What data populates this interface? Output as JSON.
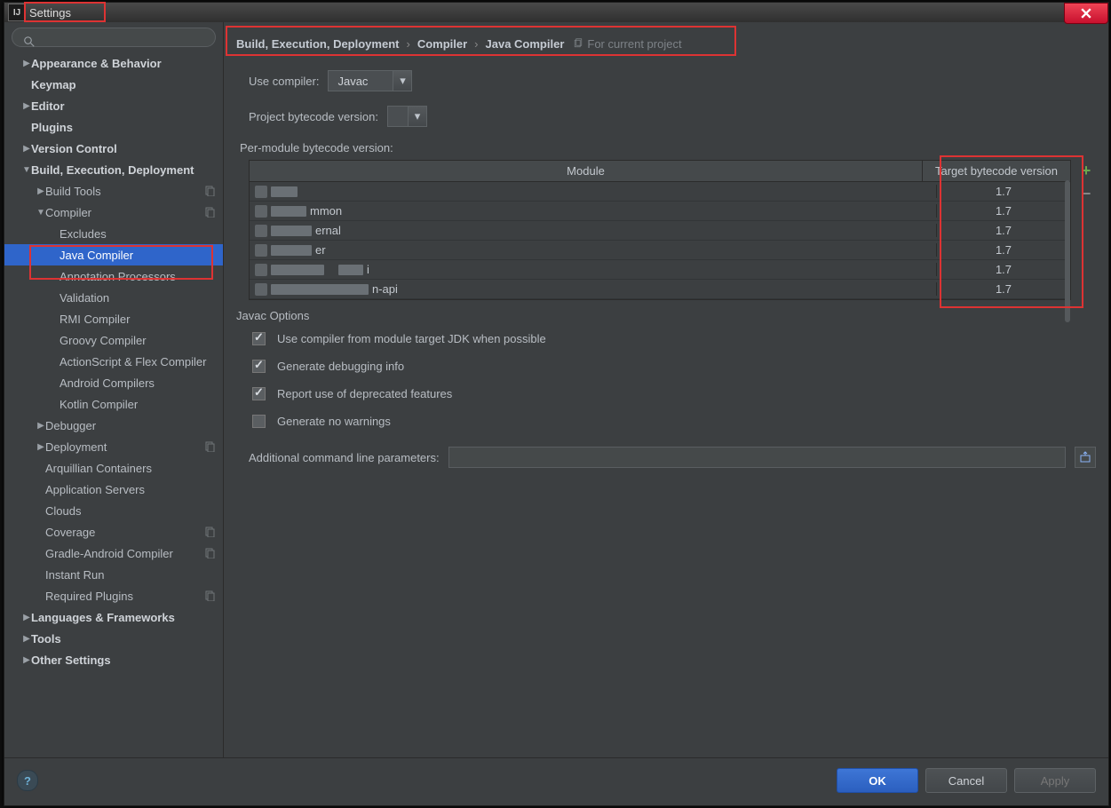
{
  "window": {
    "title": "Settings"
  },
  "search": {
    "placeholder": ""
  },
  "sidebar": [
    {
      "lvl": 1,
      "arrow": "▶",
      "bold": true,
      "label": "Appearance & Behavior"
    },
    {
      "lvl": 1,
      "arrow": "",
      "bold": true,
      "label": "Keymap"
    },
    {
      "lvl": 1,
      "arrow": "▶",
      "bold": true,
      "label": "Editor"
    },
    {
      "lvl": 1,
      "arrow": "",
      "bold": true,
      "label": "Plugins"
    },
    {
      "lvl": 1,
      "arrow": "▶",
      "bold": true,
      "label": "Version Control"
    },
    {
      "lvl": 1,
      "arrow": "▼",
      "bold": true,
      "label": "Build, Execution, Deployment"
    },
    {
      "lvl": 2,
      "arrow": "▶",
      "bold": false,
      "label": "Build Tools",
      "badge": true
    },
    {
      "lvl": 2,
      "arrow": "▼",
      "bold": false,
      "label": "Compiler",
      "badge": true
    },
    {
      "lvl": 3,
      "arrow": "",
      "bold": false,
      "label": "Excludes"
    },
    {
      "lvl": 3,
      "arrow": "",
      "bold": false,
      "label": "Java Compiler",
      "sel": true
    },
    {
      "lvl": 3,
      "arrow": "",
      "bold": false,
      "label": "Annotation Processors"
    },
    {
      "lvl": 3,
      "arrow": "",
      "bold": false,
      "label": "Validation"
    },
    {
      "lvl": 3,
      "arrow": "",
      "bold": false,
      "label": "RMI Compiler"
    },
    {
      "lvl": 3,
      "arrow": "",
      "bold": false,
      "label": "Groovy Compiler"
    },
    {
      "lvl": 3,
      "arrow": "",
      "bold": false,
      "label": "ActionScript & Flex Compiler"
    },
    {
      "lvl": 3,
      "arrow": "",
      "bold": false,
      "label": "Android Compilers"
    },
    {
      "lvl": 3,
      "arrow": "",
      "bold": false,
      "label": "Kotlin Compiler"
    },
    {
      "lvl": 2,
      "arrow": "▶",
      "bold": false,
      "label": "Debugger"
    },
    {
      "lvl": 2,
      "arrow": "▶",
      "bold": false,
      "label": "Deployment",
      "badge": true
    },
    {
      "lvl": 2,
      "arrow": "",
      "bold": false,
      "label": "Arquillian Containers"
    },
    {
      "lvl": 2,
      "arrow": "",
      "bold": false,
      "label": "Application Servers"
    },
    {
      "lvl": 2,
      "arrow": "",
      "bold": false,
      "label": "Clouds"
    },
    {
      "lvl": 2,
      "arrow": "",
      "bold": false,
      "label": "Coverage",
      "badge": true
    },
    {
      "lvl": 2,
      "arrow": "",
      "bold": false,
      "label": "Gradle-Android Compiler",
      "badge": true
    },
    {
      "lvl": 2,
      "arrow": "",
      "bold": false,
      "label": "Instant Run"
    },
    {
      "lvl": 2,
      "arrow": "",
      "bold": false,
      "label": "Required Plugins",
      "badge": true
    },
    {
      "lvl": 1,
      "arrow": "▶",
      "bold": true,
      "label": "Languages & Frameworks"
    },
    {
      "lvl": 1,
      "arrow": "▶",
      "bold": true,
      "label": "Tools"
    },
    {
      "lvl": 1,
      "arrow": "▶",
      "bold": true,
      "label": "Other Settings"
    }
  ],
  "breadcrumb": {
    "parts": [
      "Build, Execution, Deployment",
      "Compiler",
      "Java Compiler"
    ],
    "suffix": "For current project"
  },
  "useCompiler": {
    "label": "Use compiler:",
    "value": "Javac"
  },
  "projBytecode": {
    "label": "Project bytecode version:",
    "value": ""
  },
  "perModuleLabel": "Per-module bytecode version:",
  "tableHead": {
    "module": "Module",
    "ver": "Target bytecode version"
  },
  "modules": [
    {
      "blur1": 30,
      "txt": "",
      "ver": "1.7"
    },
    {
      "blur1": 40,
      "txt": "mmon",
      "ver": "1.7"
    },
    {
      "blur1": 46,
      "txt": "ernal",
      "ver": "1.7"
    },
    {
      "blur1": 46,
      "txt": "er",
      "ver": "1.7"
    },
    {
      "blur1": 60,
      "txt2": true,
      "txt": "i",
      "ver": "1.7"
    },
    {
      "blur1": 110,
      "txt": "n-api",
      "ver": "1.7"
    }
  ],
  "javacOptionsTitle": "Javac Options",
  "opts": [
    {
      "checked": true,
      "label": "Use compiler from module target JDK when possible"
    },
    {
      "checked": true,
      "label": "Generate debugging info"
    },
    {
      "checked": true,
      "label": "Report use of deprecated features"
    },
    {
      "checked": false,
      "label": "Generate no warnings"
    }
  ],
  "cmdline": {
    "label": "Additional command line parameters:",
    "value": ""
  },
  "footer": {
    "ok": "OK",
    "cancel": "Cancel",
    "apply": "Apply"
  }
}
